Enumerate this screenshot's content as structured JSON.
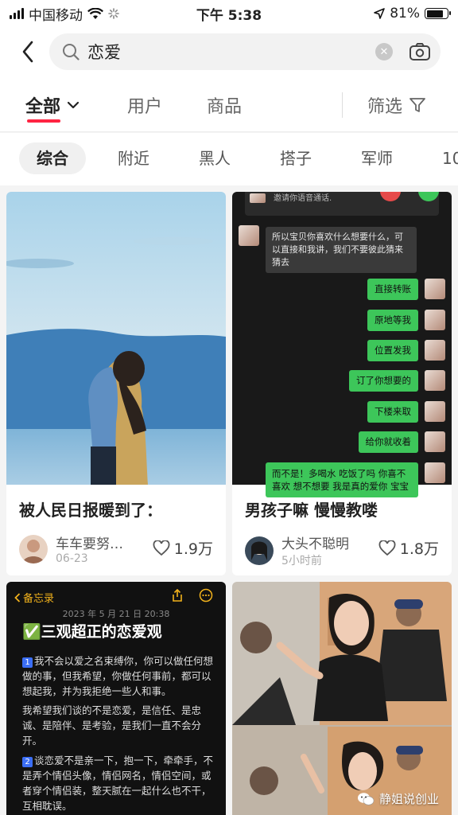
{
  "status": {
    "carrier": "中国移动",
    "time": "下午 5:38",
    "battery": "81%",
    "battery_level": 0.81
  },
  "search": {
    "query": "恋爱"
  },
  "tabs": [
    {
      "label": "全部"
    },
    {
      "label": "用户"
    },
    {
      "label": "商品"
    }
  ],
  "filter": {
    "label": "筛选"
  },
  "chips": [
    "综合",
    "附近",
    "黑人",
    "搭子",
    "军师",
    "10"
  ],
  "cards": [
    {
      "title": "被人民日报暖到了：",
      "author": "车车要努…",
      "date": "06-23",
      "likes": "1.9万"
    },
    {
      "title": "男孩子嘛 慢慢教喽",
      "author": "大头不聪明",
      "date": "5小时前",
      "likes": "1.8万"
    }
  ],
  "chat": {
    "top_hint": "邀请你语音通话.",
    "left_msg": "所以宝贝你喜欢什么想要什么，可以直接和我讲，我们不要彼此猜来猜去",
    "right_msgs": [
      "直接转账",
      "原地等我",
      "位置发我",
      "订了你想要的",
      "下楼来取",
      "给你就收着",
      "而不是！多喝水 吃饭了吗 你喜不喜欢 想不想要 我是真的爱你 宝宝"
    ]
  },
  "notes": {
    "back_label": "备忘录",
    "date": "2023 年 5 月 21 日 20:38",
    "title": "✅三观超正的恋爱观",
    "p1_num": "1",
    "p1": "我不会以爱之名束缚你，你可以做任何想做的事，但我希望，你做任何事前，都可以想起我，并为我拒绝一些人和事。",
    "p2": "我希望我们谈的不是恋爱，是信任、是忠诚、是陪伴、是考验，是我们一直不会分开。",
    "p3_num": "2",
    "p3": "谈恋爱不是亲一下，抱一下，牵牵手，不是弄个情侣头像，情侣网名，情侣空间，或者穿个情侣装，整天腻在一起什么也不干，互相耽误。"
  },
  "watermark": {
    "text": "静姐说创业"
  },
  "colors": {
    "accent": "#ff2442",
    "wechat_green": "#3dc65a",
    "notes_yellow": "#f2b21c"
  }
}
